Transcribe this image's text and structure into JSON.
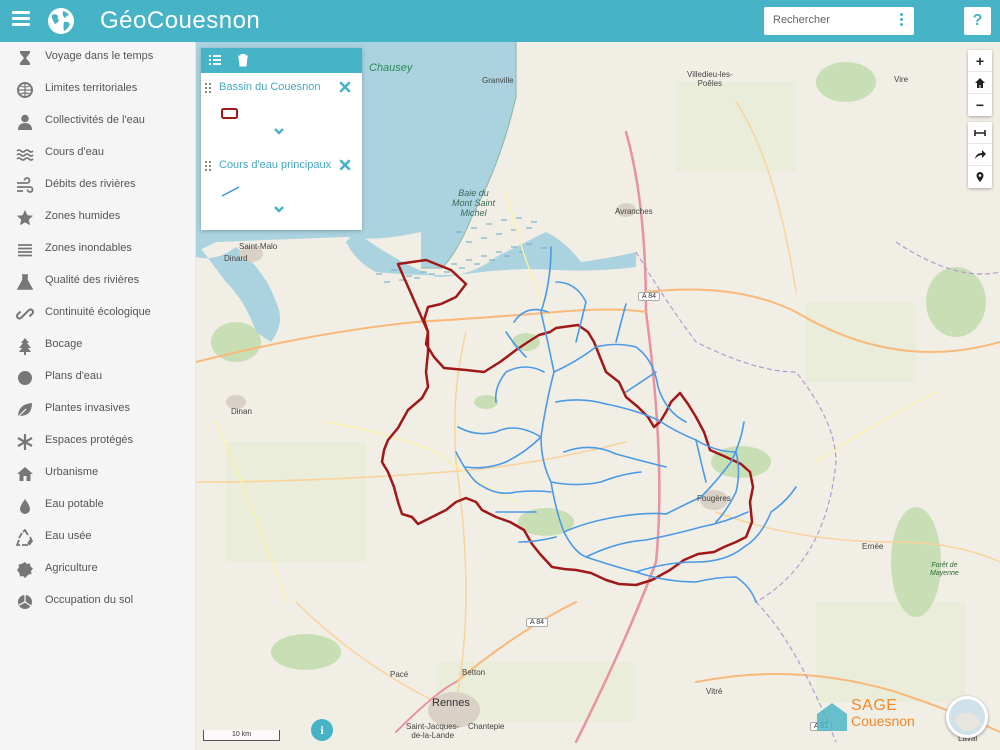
{
  "header": {
    "title": "GéoCouesnon",
    "search_placeholder": "Rechercher",
    "help_label": "?"
  },
  "sidebar": {
    "items": [
      {
        "label": "Voyage dans le temps",
        "icon": "hourglass-icon"
      },
      {
        "label": "Limites territoriales",
        "icon": "globe-icon"
      },
      {
        "label": "Collectivités de l'eau",
        "icon": "user-icon"
      },
      {
        "label": "Cours d'eau",
        "icon": "waves-icon"
      },
      {
        "label": "Débits des rivières",
        "icon": "wind-icon"
      },
      {
        "label": "Zones humides",
        "icon": "star-icon"
      },
      {
        "label": "Zones inondables",
        "icon": "lines-icon"
      },
      {
        "label": "Qualité des rivières",
        "icon": "flask-icon"
      },
      {
        "label": "Continuité écologique",
        "icon": "link-icon"
      },
      {
        "label": "Bocage",
        "icon": "tree-icon"
      },
      {
        "label": "Plans d'eau",
        "icon": "circle-icon"
      },
      {
        "label": "Plantes invasives",
        "icon": "leaf-icon"
      },
      {
        "label": "Espaces protégés",
        "icon": "asterisk-icon"
      },
      {
        "label": "Urbanisme",
        "icon": "home-icon"
      },
      {
        "label": "Eau potable",
        "icon": "drop-icon"
      },
      {
        "label": "Eau usée",
        "icon": "recycle-icon"
      },
      {
        "label": "Agriculture",
        "icon": "certificate-icon"
      },
      {
        "label": "Occupation du sol",
        "icon": "pie-icon"
      }
    ]
  },
  "layer_panel": {
    "layers": [
      {
        "name": "Bassin du Couesnon",
        "color": "#a01818"
      },
      {
        "name": "Cours d'eau principaux",
        "color": "#3b8fe0"
      }
    ]
  },
  "map": {
    "labels": {
      "chausey": "Chausey",
      "granville": "Granville",
      "villedieu": "Villedieu-les-\nPoêles",
      "vire": "Vire",
      "baie": "Baie du\nMont Saint\nMichel",
      "avranches": "Avranches",
      "saint_malo": "Saint-Malo",
      "dinard": "Dinard",
      "dinan": "Dinan",
      "fougeres": "Fougères",
      "ernee": "Ernée",
      "foret": "Forêt de\nMayenne",
      "betton": "Betton",
      "pace": "Pacé",
      "rennes": "Rennes",
      "saint_jacques": "Saint-Jacques-\nde-la-Lande",
      "chantepie": "Chantepie",
      "vitre": "Vitré",
      "laval": "Laval",
      "a84_1": "A 84",
      "a84_2": "A 84",
      "a81": "A 81"
    },
    "scale_label": "10 km",
    "info_label": "i",
    "logo_line1": "SAGE",
    "logo_line2": "Couesnon"
  },
  "colors": {
    "brand": "#46b3c6",
    "basin": "#a01818",
    "rivers": "#3b8fe0",
    "sea": "#aad3df",
    "land": "#f1eee6",
    "logo": "#f08a2a"
  }
}
